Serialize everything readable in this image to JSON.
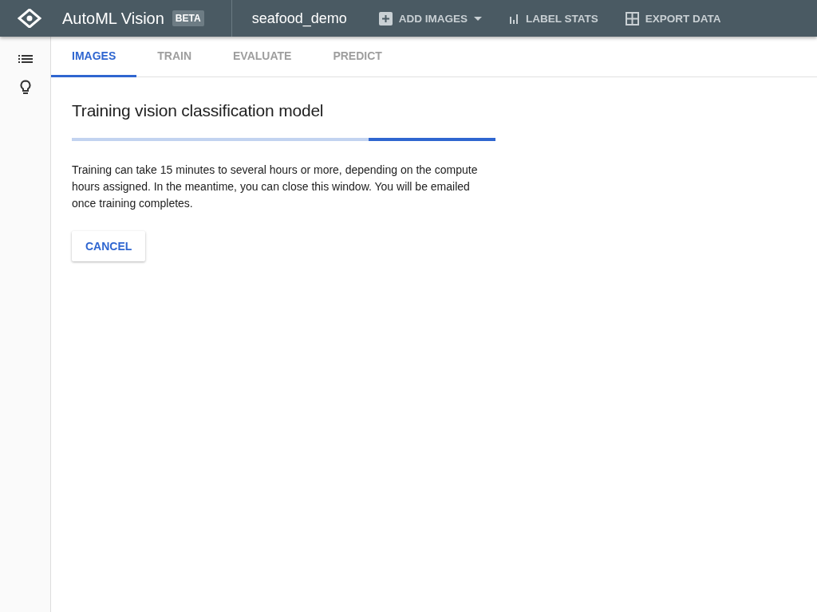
{
  "header": {
    "product": "AutoML Vision",
    "badge": "BETA",
    "dataset": "seafood_demo",
    "actions": [
      {
        "kind": "add",
        "label": "ADD IMAGES"
      },
      {
        "kind": "stats",
        "label": "LABEL STATS"
      },
      {
        "kind": "export",
        "label": "EXPORT DATA"
      }
    ]
  },
  "tabs": [
    {
      "label": "IMAGES",
      "selected": true
    },
    {
      "label": "TRAIN",
      "selected": false
    },
    {
      "label": "EVALUATE",
      "selected": false
    },
    {
      "label": "PREDICT",
      "selected": false
    }
  ],
  "content": {
    "title": "Training vision classification model",
    "progress": {
      "level": 0.3
    },
    "message": "Training can take 15 minutes to several hours or more, depending on the compute hours assigned. In the meantime, you can close this window. You will be emailed once training completes.",
    "button": "CANCEL"
  }
}
